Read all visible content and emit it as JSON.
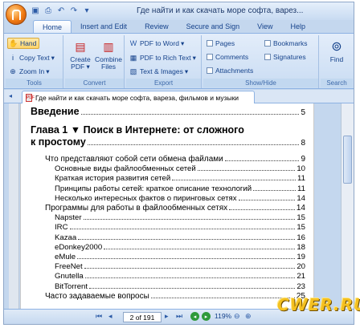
{
  "window": {
    "title": "Где найти и как скачать море софта, варез..."
  },
  "qat": {
    "items": [
      "save-icon",
      "print-icon",
      "undo-icon",
      "redo-icon",
      "dropdown-icon"
    ]
  },
  "tabs": [
    "Home",
    "Insert and Edit",
    "Review",
    "Secure and Sign",
    "View",
    "Help"
  ],
  "active_tab": "Home",
  "ribbon": {
    "tools": {
      "label": "Tools",
      "hand": "Hand",
      "copy_text": "Copy Text",
      "zoom_in": "Zoom In"
    },
    "convert": {
      "label": "Convert",
      "create_pdf": "Create PDF",
      "combine_files": "Combine Files"
    },
    "export": {
      "label": "Export",
      "to_word": "PDF to Word",
      "to_rich_text": "PDF to Rich Text",
      "text_images": "Text & Images"
    },
    "showhide": {
      "label": "Show/Hide",
      "pages": "Pages",
      "comments": "Comments",
      "attachments": "Attachments",
      "bookmarks": "Bookmarks",
      "signatures": "Signatures"
    },
    "search": {
      "label": "Search",
      "find": "Find"
    }
  },
  "document_tab": {
    "title": "Где найти и как скачать море софта, вареза, фильмов и музыки"
  },
  "toc": {
    "intro": {
      "text": "Введение",
      "page": "5"
    },
    "chapter1": {
      "text": "Глава 1 ▼ Поиск в Интернете: от сложного",
      "text2": "к простому",
      "page": "8"
    },
    "entries": [
      {
        "text": "Что представляют собой сети обмена файлами",
        "page": "9"
      },
      {
        "text": "Основные виды файлообменных сетей",
        "page": "10"
      },
      {
        "text": "Краткая история развития сетей",
        "page": "11"
      },
      {
        "text": "Принципы работы сетей: краткое описание технологий",
        "page": "11"
      },
      {
        "text": "Несколько интересных фактов о пиринговых сетях",
        "page": "14"
      },
      {
        "text": "Программы для работы в файлообменных сетях",
        "page": "14"
      },
      {
        "text": "Napster",
        "page": "15"
      },
      {
        "text": "IRC",
        "page": "15"
      },
      {
        "text": "Kazaa",
        "page": "16"
      },
      {
        "text": "eDonkey2000",
        "page": "18"
      },
      {
        "text": "eMule",
        "page": "19"
      },
      {
        "text": "FreeNet",
        "page": "20"
      },
      {
        "text": "Gnutella",
        "page": "21"
      },
      {
        "text": "BitTorrent",
        "page": "23"
      },
      {
        "text": "Часто задаваемые вопросы",
        "page": "25"
      }
    ]
  },
  "statusbar": {
    "page_indicator": "2 of 191",
    "zoom": "119%"
  },
  "watermark": {
    "text": "CWER.RU"
  }
}
